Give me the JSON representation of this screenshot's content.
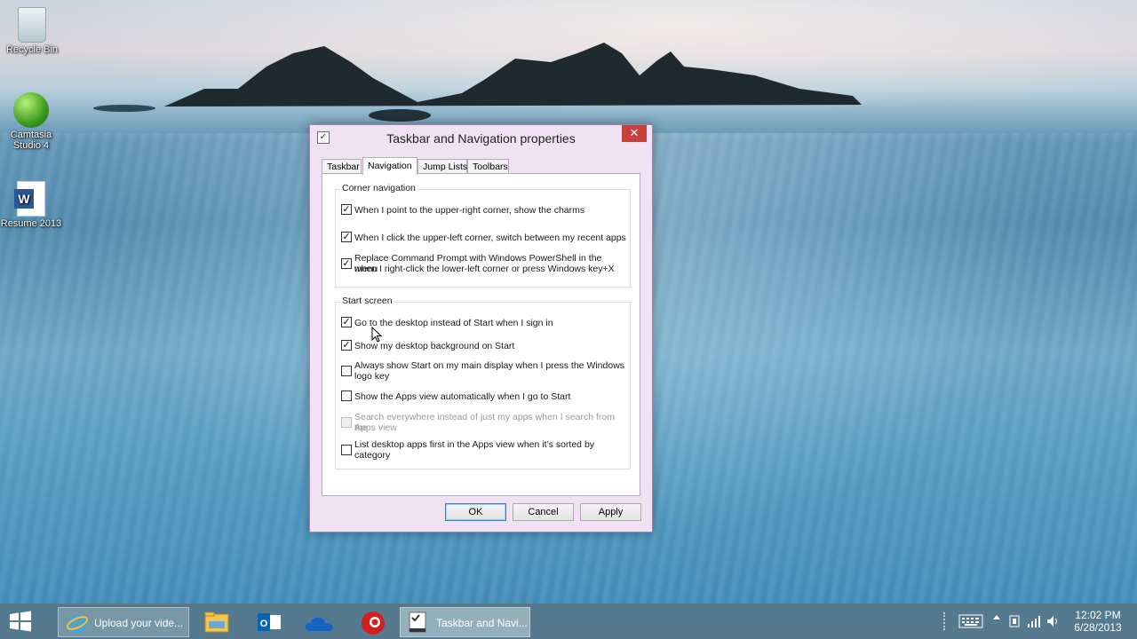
{
  "desktop": {
    "icons": [
      {
        "label": "Recycle Bin",
        "icon": "recycle-bin-icon"
      },
      {
        "label": "Camtasia Studio 4",
        "icon": "camtasia-icon"
      },
      {
        "label": "Resume 2013",
        "icon": "word-document-icon"
      }
    ]
  },
  "dialog": {
    "title": "Taskbar and Navigation properties",
    "close_glyph": "✕",
    "tabs": [
      {
        "label": "Taskbar",
        "active": false
      },
      {
        "label": "Navigation",
        "active": true
      },
      {
        "label": "Jump Lists",
        "active": false
      },
      {
        "label": "Toolbars",
        "active": false
      }
    ],
    "corner_navigation": {
      "title": "Corner navigation",
      "options": [
        {
          "label": "When I point to the upper-right corner, show the charms",
          "checked": true,
          "enabled": true
        },
        {
          "label": "When I click the upper-left corner, switch between my recent apps",
          "checked": true,
          "enabled": true
        },
        {
          "label_line1": "Replace Command Prompt with Windows PowerShell in the menu",
          "label_line2": "when I right-click the lower-left corner or press Windows key+X",
          "checked": true,
          "enabled": true
        }
      ]
    },
    "start_screen": {
      "title": "Start screen",
      "options": [
        {
          "label": "Go to the desktop instead of Start when I sign in",
          "checked": true,
          "enabled": true
        },
        {
          "label": "Show my desktop background on Start",
          "checked": true,
          "enabled": true
        },
        {
          "label_line1": "Always show Start on my main display when I press the Windows",
          "label_line2": "logo key",
          "checked": false,
          "enabled": true
        },
        {
          "label": "Show the Apps view automatically when I go to Start",
          "checked": false,
          "enabled": true
        },
        {
          "label_line1": "Search everywhere instead of just my apps when I search from the",
          "label_line2": "Apps view",
          "checked": false,
          "enabled": false
        },
        {
          "label_line1": "List desktop apps first in the Apps view when it’s sorted by",
          "label_line2": "category",
          "checked": false,
          "enabled": true
        }
      ]
    },
    "buttons": {
      "ok": "OK",
      "cancel": "Cancel",
      "apply": "Apply"
    }
  },
  "taskbar": {
    "items": [
      {
        "label": "Upload your vide...",
        "icon": "internet-explorer-icon"
      },
      {
        "label": "",
        "icon": "file-explorer-icon"
      },
      {
        "label": "",
        "icon": "outlook-icon"
      },
      {
        "label": "",
        "icon": "onedrive-icon"
      },
      {
        "label": "",
        "icon": "recorder-icon"
      },
      {
        "label": "Taskbar and Navi...",
        "icon": "taskbar-properties-icon"
      }
    ],
    "clock": {
      "time": "12:02 PM",
      "date": "6/28/2013"
    }
  },
  "colors": {
    "dialog_bg": "#f0e2f3",
    "close_button": "#c7403a",
    "taskbar": "#5a7887"
  }
}
